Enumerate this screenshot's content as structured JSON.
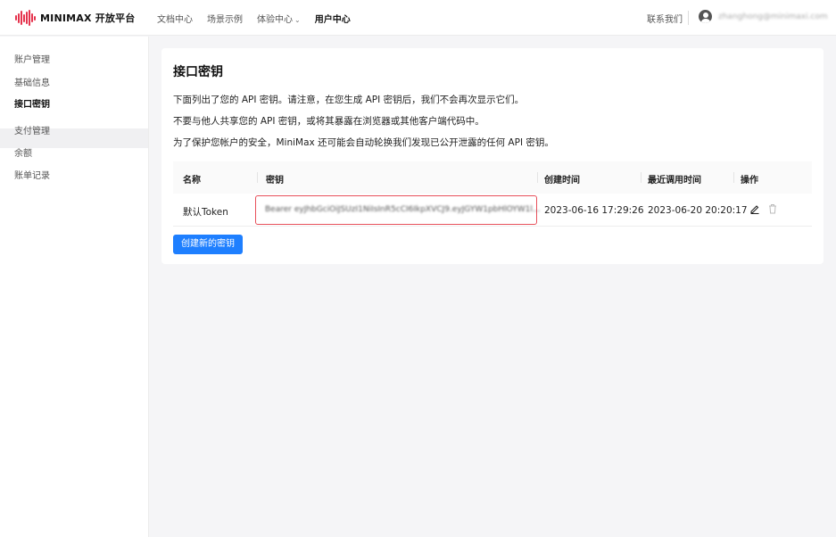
{
  "header": {
    "logo_text": "MINIMAX 开放平台",
    "nav": [
      {
        "label": "文档中心"
      },
      {
        "label": "场景示例"
      },
      {
        "label": "体验中心"
      },
      {
        "label": "用户中心"
      }
    ],
    "nav_chevron": "⌄",
    "contact": "联系我们",
    "email": "zhanghong@minimaxi.com"
  },
  "sidebar": {
    "items": [
      {
        "label": "账户管理"
      },
      {
        "label": "基础信息"
      },
      {
        "label": "接口密钥"
      },
      {
        "label": "支付管理"
      },
      {
        "label": "余额"
      },
      {
        "label": "账单记录"
      }
    ]
  },
  "main": {
    "title": "接口密钥",
    "paragraphs": [
      "下面列出了您的 API 密钥。请注意，在您生成 API 密钥后，我们不会再次显示它们。",
      "不要与他人共享您的 API 密钥，或将其暴露在浏览器或其他客户端代码中。",
      "为了保护您帐户的安全，MiniMax 还可能会自动轮换我们发现已公开泄露的任何 API 密钥。"
    ],
    "table": {
      "columns": [
        "名称",
        "密钥",
        "创建时间",
        "最近调用时间",
        "操作"
      ],
      "rows": [
        {
          "name": "默认Token",
          "key": "Bearer eyJhbGciOiJSUzI1NiIsInR5cCI6IkpXVCJ9.eyJGYW1pbHlOYW1l...",
          "created": "2023-06-16 17:29:26",
          "last_used": "2023-06-20 20:20:17"
        }
      ]
    },
    "create_button": "创建新的密钥"
  },
  "colors": {
    "accent": "#1e7fff",
    "highlight_border": "#e8505b",
    "logo": "#e5334d"
  }
}
